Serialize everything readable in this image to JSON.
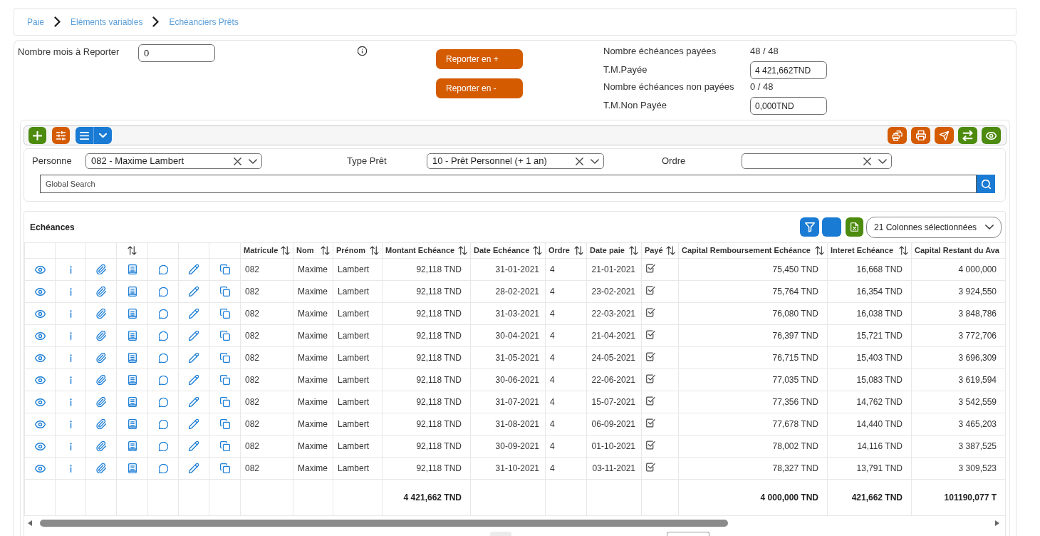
{
  "breadcrumb": [
    {
      "label": "Paie"
    },
    {
      "label": "Eléments variables"
    },
    {
      "label": "Echéanciers Prêts"
    }
  ],
  "report": {
    "months_label": "Nombre mois à Reporter",
    "months_value": "0",
    "buttons": [
      {
        "label": "Reporter en +"
      },
      {
        "label": "Reporter en -"
      }
    ]
  },
  "summary": [
    {
      "kind": "text",
      "label": "Nombre échéances payées",
      "value": "48 / 48"
    },
    {
      "kind": "field",
      "label": "T.M.Payée",
      "value": "4 421,662TND"
    },
    {
      "kind": "text",
      "label": "Nombre échéances non payées",
      "value": "0 / 48"
    },
    {
      "kind": "field",
      "label": "T.M.Non Payée",
      "value": "0,000TND"
    }
  ],
  "toolbar": {
    "left": [
      {
        "kind": "add",
        "color": "#4c8b0e"
      },
      {
        "kind": "settings",
        "color": "#d45b00"
      },
      {
        "kind": "list",
        "color": "#1a7bd4"
      }
    ],
    "right": [
      {
        "kind": "print-stack",
        "color": "#d45b00"
      },
      {
        "kind": "print",
        "color": "#d45b00"
      },
      {
        "kind": "send",
        "color": "#d45b00"
      },
      {
        "kind": "swap",
        "color": "#4c8b0e"
      },
      {
        "kind": "view",
        "color": "#4c8b0e"
      }
    ]
  },
  "filters": [
    {
      "label": "Personne",
      "value": "082 - Maxime Lambert"
    },
    {
      "label": "Type Prêt",
      "value": "10 - Prêt Personnel (+ 1 an)"
    },
    {
      "label": "Ordre"
    }
  ],
  "global_search": {
    "placeholder": "Global Search"
  },
  "table": {
    "title": "Echéances",
    "tools": [
      {
        "kind": "filter",
        "color": "#1a7bd4"
      },
      {
        "kind": "blank",
        "color": "#1a7bd4"
      },
      {
        "kind": "excel",
        "color": "#4c8b0e"
      }
    ],
    "columns_select": "21 Colonnes sélectionnées",
    "action_columns": [
      {
        "kind": "view",
        "sortable": false
      },
      {
        "kind": "info",
        "sortable": false
      },
      {
        "kind": "attach",
        "sortable": false
      },
      {
        "kind": "notes",
        "sortable": true
      },
      {
        "kind": "comment",
        "sortable": false
      },
      {
        "kind": "edit",
        "sortable": false
      },
      {
        "kind": "copy",
        "sortable": false
      }
    ],
    "columns": [
      {
        "label": "Matricule",
        "kind": "text",
        "sortable": true
      },
      {
        "label": "Nom",
        "kind": "text",
        "sortable": true
      },
      {
        "label": "Prénom",
        "kind": "text",
        "sortable": true
      },
      {
        "label": "Montant Echéance",
        "kind": "amount",
        "sortable": true,
        "total": "4 421,662 TND"
      },
      {
        "label": "Date Echéance",
        "kind": "date",
        "sortable": true
      },
      {
        "label": "Ordre",
        "kind": "text",
        "sortable": true
      },
      {
        "label": "Date paie",
        "kind": "date",
        "sortable": true
      },
      {
        "label": "Payé",
        "kind": "check",
        "sortable": true
      },
      {
        "label": "Capital Remboursement Echéance",
        "kind": "amount",
        "sortable": true,
        "total": "4 000,000 TND"
      },
      {
        "label": "Interet Echéance",
        "kind": "amount",
        "sortable": true,
        "total": "421,662 TND"
      },
      {
        "label": "Capital Restant du Ava",
        "kind": "amount",
        "sortable": false,
        "total": "101190,077 T"
      }
    ],
    "rows": [
      {
        "values": [
          "082",
          "Maxime",
          "Lambert",
          "92,118 TND",
          "31-01-2021",
          "4",
          "21-01-2021",
          "75,450 TND",
          "16,668 TND",
          "4 000,000"
        ],
        "paid": true
      },
      {
        "values": [
          "082",
          "Maxime",
          "Lambert",
          "92,118 TND",
          "28-02-2021",
          "4",
          "23-02-2021",
          "75,764 TND",
          "16,354 TND",
          "3 924,550"
        ],
        "paid": true
      },
      {
        "values": [
          "082",
          "Maxime",
          "Lambert",
          "92,118 TND",
          "31-03-2021",
          "4",
          "22-03-2021",
          "76,080 TND",
          "16,038 TND",
          "3 848,786"
        ],
        "paid": true
      },
      {
        "values": [
          "082",
          "Maxime",
          "Lambert",
          "92,118 TND",
          "30-04-2021",
          "4",
          "21-04-2021",
          "76,397 TND",
          "15,721 TND",
          "3 772,706"
        ],
        "paid": true
      },
      {
        "values": [
          "082",
          "Maxime",
          "Lambert",
          "92,118 TND",
          "31-05-2021",
          "4",
          "24-05-2021",
          "76,715 TND",
          "15,403 TND",
          "3 696,309"
        ],
        "paid": true
      },
      {
        "values": [
          "082",
          "Maxime",
          "Lambert",
          "92,118 TND",
          "30-06-2021",
          "4",
          "22-06-2021",
          "77,035 TND",
          "15,083 TND",
          "3 619,594"
        ],
        "paid": true
      },
      {
        "values": [
          "082",
          "Maxime",
          "Lambert",
          "92,118 TND",
          "31-07-2021",
          "4",
          "15-07-2021",
          "77,356 TND",
          "14,762 TND",
          "3 542,559"
        ],
        "paid": true
      },
      {
        "values": [
          "082",
          "Maxime",
          "Lambert",
          "92,118 TND",
          "31-08-2021",
          "4",
          "06-09-2021",
          "77,678 TND",
          "14,440 TND",
          "3 465,203"
        ],
        "paid": true
      },
      {
        "values": [
          "082",
          "Maxime",
          "Lambert",
          "92,118 TND",
          "30-09-2021",
          "4",
          "01-10-2021",
          "78,002 TND",
          "14,116 TND",
          "3 387,525"
        ],
        "paid": true
      },
      {
        "values": [
          "082",
          "Maxime",
          "Lambert",
          "92,118 TND",
          "31-10-2021",
          "4",
          "03-11-2021",
          "78,327 TND",
          "13,791 TND",
          "3 309,523"
        ],
        "paid": true
      }
    ]
  }
}
